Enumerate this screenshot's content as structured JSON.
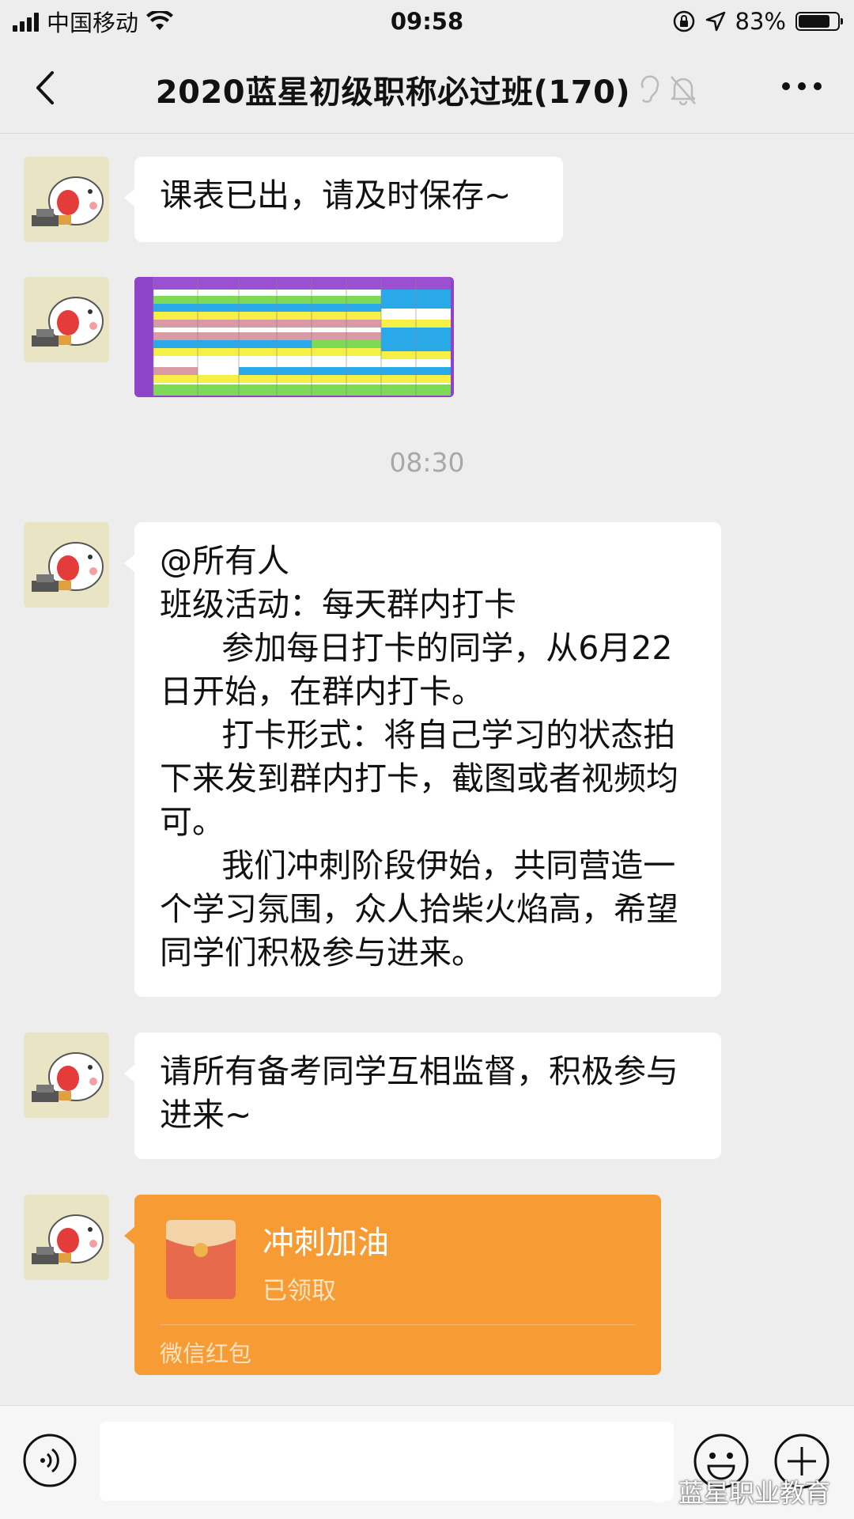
{
  "status_bar": {
    "carrier": "中国移动",
    "time": "09:58",
    "battery_percent": "83%",
    "battery_level": 0.83
  },
  "nav": {
    "title": "2020蓝星初级职称必过班(170)"
  },
  "messages": [
    {
      "type": "text",
      "text": "课表已出，请及时保存~"
    },
    {
      "type": "image",
      "icon": "schedule-image"
    },
    {
      "type": "text",
      "text": "@所有人\n班级活动：每天群内打卡\n      参加每日打卡的同学，从6月22日开始，在群内打卡。\n      打卡形式：将自己学习的状态拍下来发到群内打卡，截图或者视频均可。\n      我们冲刺阶段伊始，共同营造一个学习氛围，众人拾柴火焰高，希望同学们积极参与进来。"
    },
    {
      "type": "text",
      "text": "请所有备考同学互相监督，积极参与进来~"
    },
    {
      "type": "red_packet",
      "title": "冲刺加油",
      "status": "已领取",
      "footer": "微信红包"
    }
  ],
  "time_divider": "08:30",
  "watermark": "蓝星职业教育",
  "colors": {
    "background": "#ededed",
    "bubble": "#ffffff",
    "red_packet": "#f79c34",
    "avatar_bg": "#e9e5c4"
  }
}
